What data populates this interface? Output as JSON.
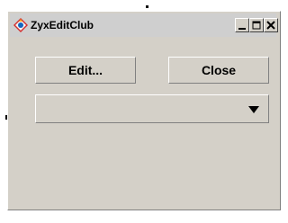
{
  "window": {
    "title": "ZyxEditClub",
    "icon": "java-icon"
  },
  "buttons": {
    "edit_label": "Edit...",
    "close_label": "Close"
  },
  "combo": {
    "selected": ""
  },
  "titlebar_controls": {
    "minimize": "minimize-icon",
    "maximize": "maximize-icon",
    "close": "close-icon"
  }
}
